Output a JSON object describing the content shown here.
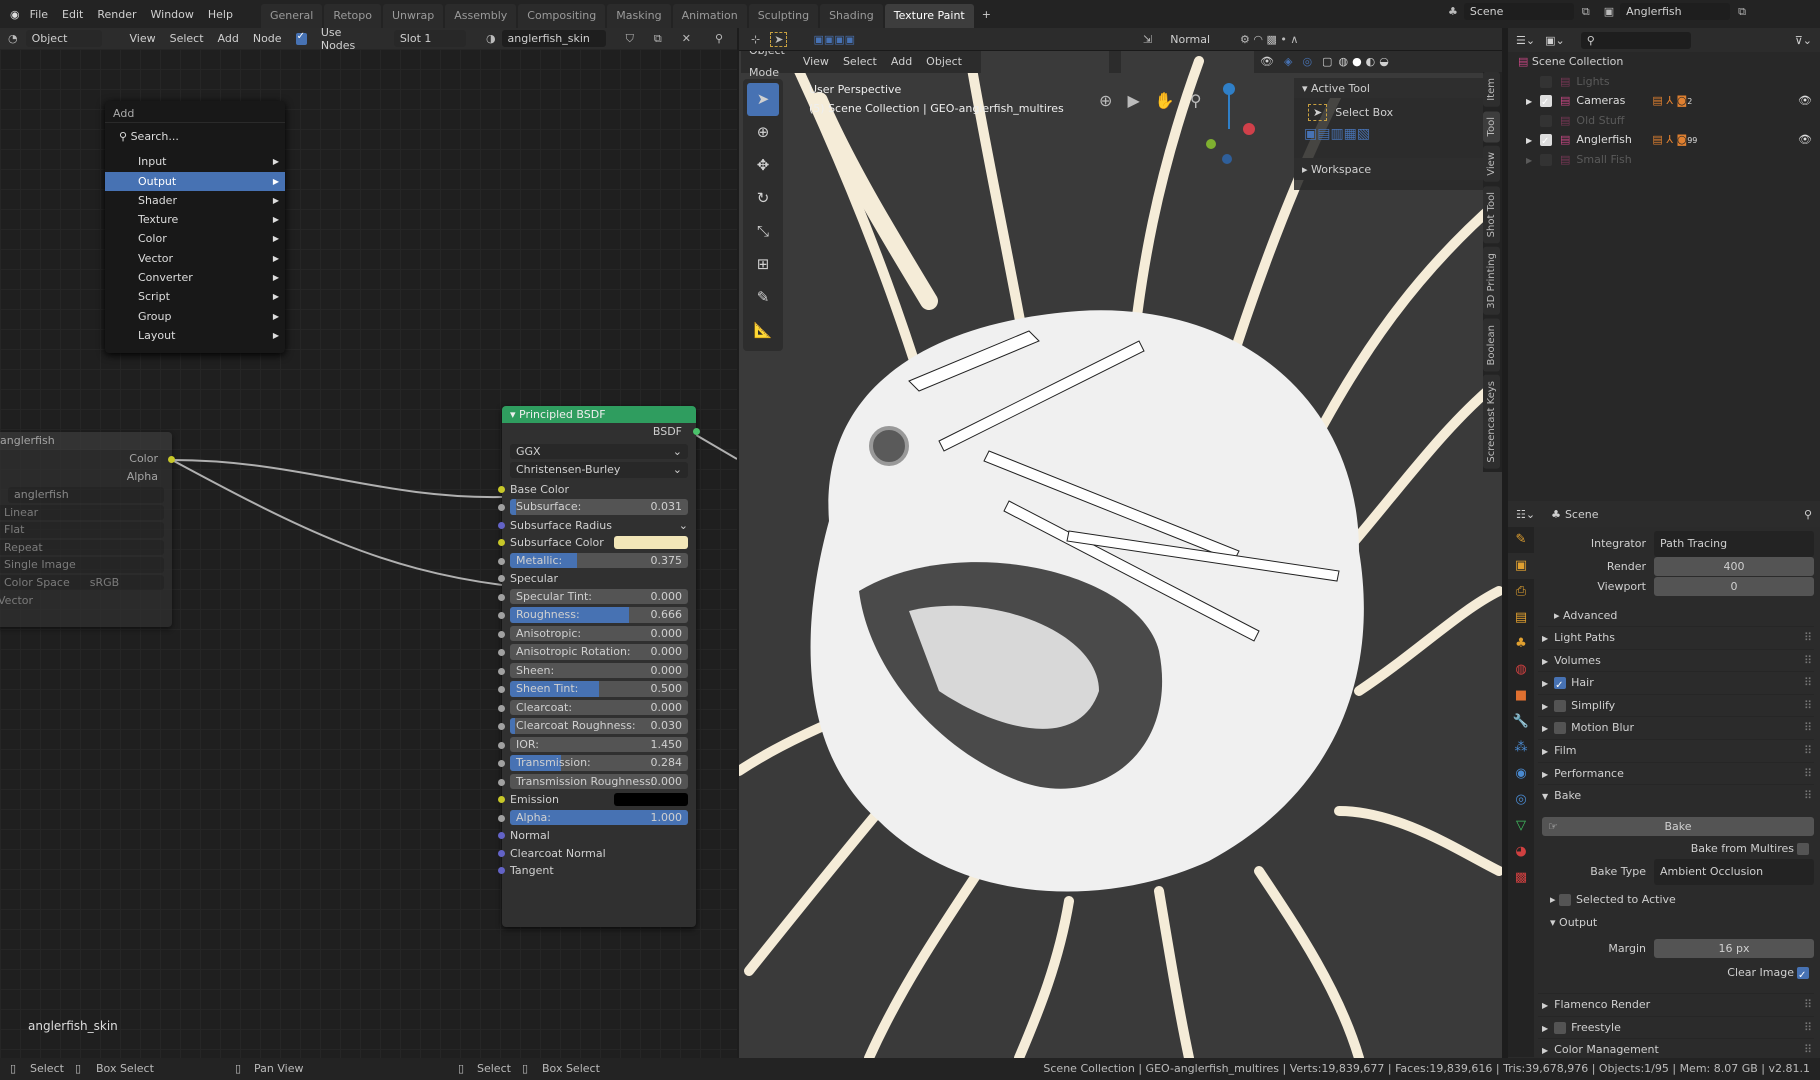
{
  "topbar": {
    "menus": [
      "File",
      "Edit",
      "Render",
      "Window",
      "Help"
    ],
    "workspaces": [
      "General",
      "Retopo",
      "Unwrap",
      "Assembly",
      "Compositing",
      "Masking",
      "Animation",
      "Sculpting",
      "Shading",
      "Texture Paint"
    ],
    "active_workspace": "Texture Paint",
    "scene": "Scene",
    "view_layer": "Anglerfish"
  },
  "node_header": {
    "mode": "Object",
    "menus": [
      "View",
      "Select",
      "Add",
      "Node"
    ],
    "use_nodes": "Use Nodes",
    "slot": "Slot 1",
    "material": "anglerfish_skin"
  },
  "add_menu": {
    "title": "Add",
    "search": "Search...",
    "items": [
      "Input",
      "Output",
      "Shader",
      "Texture",
      "Color",
      "Vector",
      "Converter",
      "Script",
      "Group",
      "Layout"
    ],
    "highlighted": "Output"
  },
  "image_node": {
    "title": "anglerfish",
    "outputs": [
      "Color",
      "Alpha"
    ],
    "image": "anglerfish",
    "options": [
      "Linear",
      "Flat",
      "Repeat",
      "Single Image"
    ],
    "color_space_label": "Color Space",
    "color_space": "sRGB",
    "input": "Vector"
  },
  "bsdf_node": {
    "title": "Principled BSDF",
    "output": "BSDF",
    "distribution": "GGX",
    "subsurface_method": "Christensen-Burley",
    "rows": [
      {
        "type": "label",
        "label": "Base Color",
        "sock": "#c7c729"
      },
      {
        "type": "slider",
        "label": "Subsurface:",
        "value": "0.031",
        "fill": 0.031
      },
      {
        "type": "drop",
        "label": "Subsurface Radius",
        "sock": "#6363c7"
      },
      {
        "type": "color",
        "label": "Subsurface Color",
        "color": "#f2e6b8",
        "sock": "#c7c729"
      },
      {
        "type": "slider",
        "label": "Metallic:",
        "value": "0.375",
        "fill": 0.375
      },
      {
        "type": "label",
        "label": "Specular"
      },
      {
        "type": "slider",
        "label": "Specular Tint:",
        "value": "0.000",
        "fill": 0
      },
      {
        "type": "slider",
        "label": "Roughness:",
        "value": "0.666",
        "fill": 0.666
      },
      {
        "type": "slider",
        "label": "Anisotropic:",
        "value": "0.000",
        "fill": 0
      },
      {
        "type": "slider",
        "label": "Anisotropic Rotation:",
        "value": "0.000",
        "fill": 0
      },
      {
        "type": "slider",
        "label": "Sheen:",
        "value": "0.000",
        "fill": 0
      },
      {
        "type": "slider",
        "label": "Sheen Tint:",
        "value": "0.500",
        "fill": 0.5
      },
      {
        "type": "slider",
        "label": "Clearcoat:",
        "value": "0.000",
        "fill": 0
      },
      {
        "type": "slider",
        "label": "Clearcoat Roughness:",
        "value": "0.030",
        "fill": 0.03
      },
      {
        "type": "slider",
        "label": "IOR:",
        "value": "1.450",
        "fill": 0
      },
      {
        "type": "slider",
        "label": "Transmission:",
        "value": "0.284",
        "fill": 0.284
      },
      {
        "type": "slider",
        "label": "Transmission Roughness:",
        "value": "0.000",
        "fill": 0
      },
      {
        "type": "color",
        "label": "Emission",
        "color": "#000000",
        "sock": "#c7c729"
      },
      {
        "type": "slider",
        "label": "Alpha:",
        "value": "1.000",
        "fill": 1
      },
      {
        "type": "label",
        "label": "Normal",
        "sock": "#6363c7"
      },
      {
        "type": "label",
        "label": "Clearcoat Normal",
        "sock": "#6363c7"
      },
      {
        "type": "label",
        "label": "Tangent",
        "sock": "#6363c7"
      }
    ]
  },
  "node_tree_name": "anglerfish_skin",
  "viewport": {
    "mode": "Object Mode",
    "menus": [
      "View",
      "Select",
      "Add",
      "Object"
    ],
    "transform": "Normal",
    "overlay_title": "User Perspective",
    "overlay_sub": "(5) Scene Collection | GEO-anglerfish_multires"
  },
  "npanel": {
    "active_tool": "Active Tool",
    "tool": "Select Box",
    "workspace": "Workspace",
    "tabs": [
      "Item",
      "Tool",
      "View",
      "Shot Tool",
      "3D Printing",
      "Boolean",
      "Screencast Keys"
    ]
  },
  "outliner": {
    "root": "Scene Collection",
    "items": [
      {
        "name": "Lights",
        "checked": false,
        "dim": true
      },
      {
        "name": "Cameras",
        "checked": true,
        "dim": false,
        "badge": "2"
      },
      {
        "name": "Old Stuff",
        "checked": false,
        "dim": true
      },
      {
        "name": "Anglerfish",
        "checked": true,
        "dim": false,
        "badge": "99"
      },
      {
        "name": "Small Fish",
        "checked": false,
        "dim": true
      }
    ]
  },
  "properties": {
    "context": "Scene",
    "integrator_label": "Integrator",
    "integrator": "Path Tracing",
    "render_label": "Render",
    "render": "400",
    "viewport_label": "Viewport",
    "viewport": "0",
    "advanced": "Advanced",
    "panels": [
      {
        "label": "Light Paths"
      },
      {
        "label": "Volumes"
      },
      {
        "label": "Hair",
        "check": true
      },
      {
        "label": "Simplify",
        "check": false
      },
      {
        "label": "Motion Blur",
        "check": false
      },
      {
        "label": "Film"
      },
      {
        "label": "Performance"
      },
      {
        "label": "Bake",
        "open": true
      }
    ],
    "bake_button": "Bake",
    "bake_from_multires": "Bake from Multires",
    "bake_type_label": "Bake Type",
    "bake_type": "Ambient Occlusion",
    "selected_to_active": "Selected to Active",
    "output": "Output",
    "margin_label": "Margin",
    "margin": "16 px",
    "clear_image": "Clear Image",
    "panels2": [
      {
        "label": "Flamenco Render"
      },
      {
        "label": "Freestyle",
        "check": false
      },
      {
        "label": "Color Management"
      }
    ]
  },
  "status": {
    "left": [
      "Select",
      "Box Select",
      "Pan View",
      "Select",
      "Box Select"
    ],
    "right": "Scene Collection | GEO-anglerfish_multires | Verts:19,839,677 | Faces:19,839,616 | Tris:39,678,976 | Objects:1/95 | Mem: 8.07 GB | v2.81.1"
  },
  "colors": {
    "accent": "#4772b3",
    "node_header_shader": "#2f9d5f",
    "collection": "#c2457f"
  }
}
